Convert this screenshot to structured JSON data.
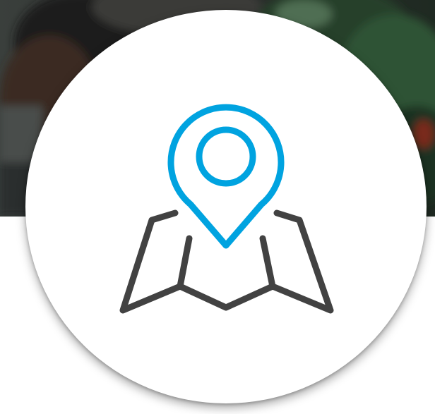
{
  "colors": {
    "pin_accent": "#00a3e0",
    "map_stroke": "#424242",
    "circle_fill": "#ffffff",
    "background_below": "#ffffff"
  },
  "icons": {
    "main": "map-with-location-pin-icon",
    "pin": "location-pin-icon",
    "map": "folded-map-icon"
  },
  "background": {
    "hero": "blurred-photo-people-and-plants"
  }
}
